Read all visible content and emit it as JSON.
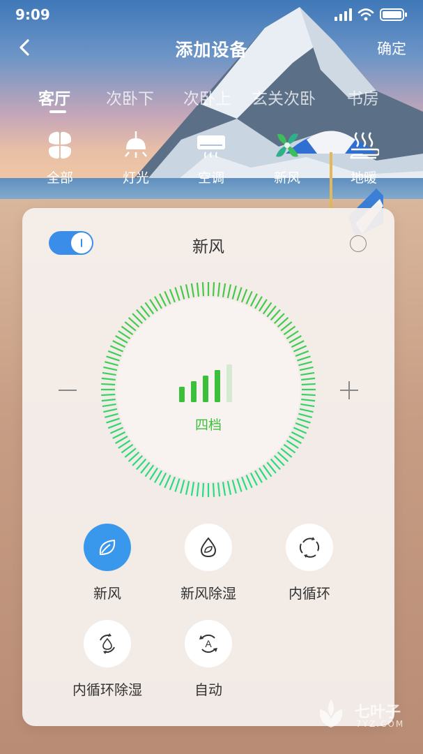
{
  "status_bar": {
    "time": "9:09"
  },
  "nav": {
    "title": "添加设备",
    "confirm_label": "确定"
  },
  "rooms": [
    {
      "label": "客厅",
      "active": true
    },
    {
      "label": "次卧下",
      "active": false
    },
    {
      "label": "次卧上",
      "active": false
    },
    {
      "label": "玄关次卧",
      "active": false
    },
    {
      "label": "书房",
      "active": false
    }
  ],
  "categories": [
    {
      "label": "全部",
      "icon": "four-petal-grid-icon"
    },
    {
      "label": "灯光",
      "icon": "lamp-icon"
    },
    {
      "label": "空调",
      "icon": "air-conditioner-icon"
    },
    {
      "label": "新风",
      "icon": "fan-icon"
    },
    {
      "label": "地暖",
      "icon": "floor-heating-icon"
    }
  ],
  "card": {
    "title": "新风",
    "power_on": true,
    "selected": false,
    "fan_level_label": "四档",
    "fan_level": 4,
    "fan_level_max": 5,
    "accent_color": "#3cbf3a",
    "active_color": "#3a98ec",
    "modes": [
      {
        "label": "新风",
        "icon": "leaf-icon",
        "active": true
      },
      {
        "label": "新风除湿",
        "icon": "water-drop-leaf-icon",
        "active": false
      },
      {
        "label": "内循环",
        "icon": "circulation-icon",
        "active": false
      },
      {
        "label": "内循环除湿",
        "icon": "circulation-drop-icon",
        "active": false
      },
      {
        "label": "自动",
        "icon": "auto-mode-icon",
        "active": false
      }
    ]
  },
  "watermark": {
    "brand": "七叶子",
    "domain": "7YZ.COM"
  }
}
